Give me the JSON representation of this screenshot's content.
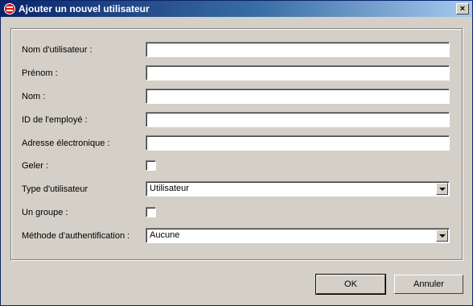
{
  "window": {
    "title": "Ajouter un nouvel utilisateur",
    "close_label": "×"
  },
  "form": {
    "username_label": "Nom d'utilisateur :",
    "username_value": "",
    "firstname_label": "Prénom :",
    "firstname_value": "",
    "lastname_label": "Nom :",
    "lastname_value": "",
    "employee_id_label": "ID de l'employé :",
    "employee_id_value": "",
    "email_label": "Adresse électronique :",
    "email_value": "",
    "freeze_label": "Geler :",
    "freeze_checked": false,
    "user_type_label": "Type d'utilisateur",
    "user_type_value": "Utilisateur",
    "group_label": "Un groupe :",
    "group_checked": false,
    "auth_method_label": "Méthode d'authentification :",
    "auth_method_value": "Aucune"
  },
  "buttons": {
    "ok": "OK",
    "cancel": "Annuler"
  },
  "icons": {
    "app": "app-icon",
    "close": "close-icon",
    "dropdown": "chevron-down-icon"
  }
}
